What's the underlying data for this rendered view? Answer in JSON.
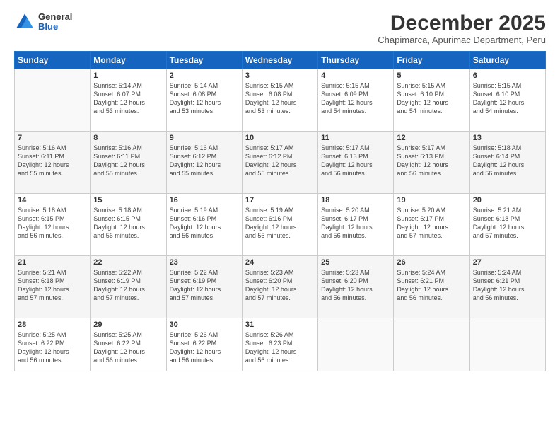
{
  "logo": {
    "general": "General",
    "blue": "Blue"
  },
  "header": {
    "month": "December 2025",
    "location": "Chapimarca, Apurimac Department, Peru"
  },
  "weekdays": [
    "Sunday",
    "Monday",
    "Tuesday",
    "Wednesday",
    "Thursday",
    "Friday",
    "Saturday"
  ],
  "weeks": [
    [
      {
        "day": "",
        "text": ""
      },
      {
        "day": "1",
        "text": "Sunrise: 5:14 AM\nSunset: 6:07 PM\nDaylight: 12 hours\nand 53 minutes."
      },
      {
        "day": "2",
        "text": "Sunrise: 5:14 AM\nSunset: 6:08 PM\nDaylight: 12 hours\nand 53 minutes."
      },
      {
        "day": "3",
        "text": "Sunrise: 5:15 AM\nSunset: 6:08 PM\nDaylight: 12 hours\nand 53 minutes."
      },
      {
        "day": "4",
        "text": "Sunrise: 5:15 AM\nSunset: 6:09 PM\nDaylight: 12 hours\nand 54 minutes."
      },
      {
        "day": "5",
        "text": "Sunrise: 5:15 AM\nSunset: 6:10 PM\nDaylight: 12 hours\nand 54 minutes."
      },
      {
        "day": "6",
        "text": "Sunrise: 5:15 AM\nSunset: 6:10 PM\nDaylight: 12 hours\nand 54 minutes."
      }
    ],
    [
      {
        "day": "7",
        "text": "Sunrise: 5:16 AM\nSunset: 6:11 PM\nDaylight: 12 hours\nand 55 minutes."
      },
      {
        "day": "8",
        "text": "Sunrise: 5:16 AM\nSunset: 6:11 PM\nDaylight: 12 hours\nand 55 minutes."
      },
      {
        "day": "9",
        "text": "Sunrise: 5:16 AM\nSunset: 6:12 PM\nDaylight: 12 hours\nand 55 minutes."
      },
      {
        "day": "10",
        "text": "Sunrise: 5:17 AM\nSunset: 6:12 PM\nDaylight: 12 hours\nand 55 minutes."
      },
      {
        "day": "11",
        "text": "Sunrise: 5:17 AM\nSunset: 6:13 PM\nDaylight: 12 hours\nand 56 minutes."
      },
      {
        "day": "12",
        "text": "Sunrise: 5:17 AM\nSunset: 6:13 PM\nDaylight: 12 hours\nand 56 minutes."
      },
      {
        "day": "13",
        "text": "Sunrise: 5:18 AM\nSunset: 6:14 PM\nDaylight: 12 hours\nand 56 minutes."
      }
    ],
    [
      {
        "day": "14",
        "text": "Sunrise: 5:18 AM\nSunset: 6:15 PM\nDaylight: 12 hours\nand 56 minutes."
      },
      {
        "day": "15",
        "text": "Sunrise: 5:18 AM\nSunset: 6:15 PM\nDaylight: 12 hours\nand 56 minutes."
      },
      {
        "day": "16",
        "text": "Sunrise: 5:19 AM\nSunset: 6:16 PM\nDaylight: 12 hours\nand 56 minutes."
      },
      {
        "day": "17",
        "text": "Sunrise: 5:19 AM\nSunset: 6:16 PM\nDaylight: 12 hours\nand 56 minutes."
      },
      {
        "day": "18",
        "text": "Sunrise: 5:20 AM\nSunset: 6:17 PM\nDaylight: 12 hours\nand 56 minutes."
      },
      {
        "day": "19",
        "text": "Sunrise: 5:20 AM\nSunset: 6:17 PM\nDaylight: 12 hours\nand 57 minutes."
      },
      {
        "day": "20",
        "text": "Sunrise: 5:21 AM\nSunset: 6:18 PM\nDaylight: 12 hours\nand 57 minutes."
      }
    ],
    [
      {
        "day": "21",
        "text": "Sunrise: 5:21 AM\nSunset: 6:18 PM\nDaylight: 12 hours\nand 57 minutes."
      },
      {
        "day": "22",
        "text": "Sunrise: 5:22 AM\nSunset: 6:19 PM\nDaylight: 12 hours\nand 57 minutes."
      },
      {
        "day": "23",
        "text": "Sunrise: 5:22 AM\nSunset: 6:19 PM\nDaylight: 12 hours\nand 57 minutes."
      },
      {
        "day": "24",
        "text": "Sunrise: 5:23 AM\nSunset: 6:20 PM\nDaylight: 12 hours\nand 57 minutes."
      },
      {
        "day": "25",
        "text": "Sunrise: 5:23 AM\nSunset: 6:20 PM\nDaylight: 12 hours\nand 56 minutes."
      },
      {
        "day": "26",
        "text": "Sunrise: 5:24 AM\nSunset: 6:21 PM\nDaylight: 12 hours\nand 56 minutes."
      },
      {
        "day": "27",
        "text": "Sunrise: 5:24 AM\nSunset: 6:21 PM\nDaylight: 12 hours\nand 56 minutes."
      }
    ],
    [
      {
        "day": "28",
        "text": "Sunrise: 5:25 AM\nSunset: 6:22 PM\nDaylight: 12 hours\nand 56 minutes."
      },
      {
        "day": "29",
        "text": "Sunrise: 5:25 AM\nSunset: 6:22 PM\nDaylight: 12 hours\nand 56 minutes."
      },
      {
        "day": "30",
        "text": "Sunrise: 5:26 AM\nSunset: 6:22 PM\nDaylight: 12 hours\nand 56 minutes."
      },
      {
        "day": "31",
        "text": "Sunrise: 5:26 AM\nSunset: 6:23 PM\nDaylight: 12 hours\nand 56 minutes."
      },
      {
        "day": "",
        "text": ""
      },
      {
        "day": "",
        "text": ""
      },
      {
        "day": "",
        "text": ""
      }
    ]
  ]
}
